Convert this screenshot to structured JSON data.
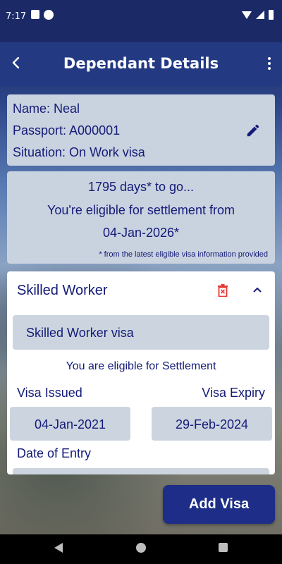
{
  "status_bar": {
    "time": "7:17"
  },
  "app_bar": {
    "title": "Dependant Details"
  },
  "dependant": {
    "name_line": "Name: Neal",
    "passport_line": "Passport: A000001",
    "situation_line": "Situation:  On Work visa"
  },
  "settlement": {
    "days_line": "1795 days* to go...",
    "eligible_line": "You're eligible for settlement from",
    "date_line": "04-Jan-2026*",
    "footnote": "* from the latest eligible visa information provided"
  },
  "visa": {
    "title": "Skilled Worker",
    "type_value": "Skilled Worker visa",
    "eligibility_text": "You are eligible for Settlement",
    "issued_label": "Visa Issued",
    "issued_value": "04-Jan-2021",
    "expiry_label": "Visa Expiry",
    "expiry_value": "29-Feb-2024",
    "entry_label": "Date of Entry"
  },
  "actions": {
    "add_visa": "Add Visa"
  },
  "colors": {
    "primary": "#1d2d88",
    "text": "#141b78",
    "card_bg": "#c9d2df",
    "delete": "#e53935"
  },
  "icons": [
    "back-icon",
    "more-vert-icon",
    "edit-icon",
    "delete-icon",
    "chevron-up-icon"
  ]
}
